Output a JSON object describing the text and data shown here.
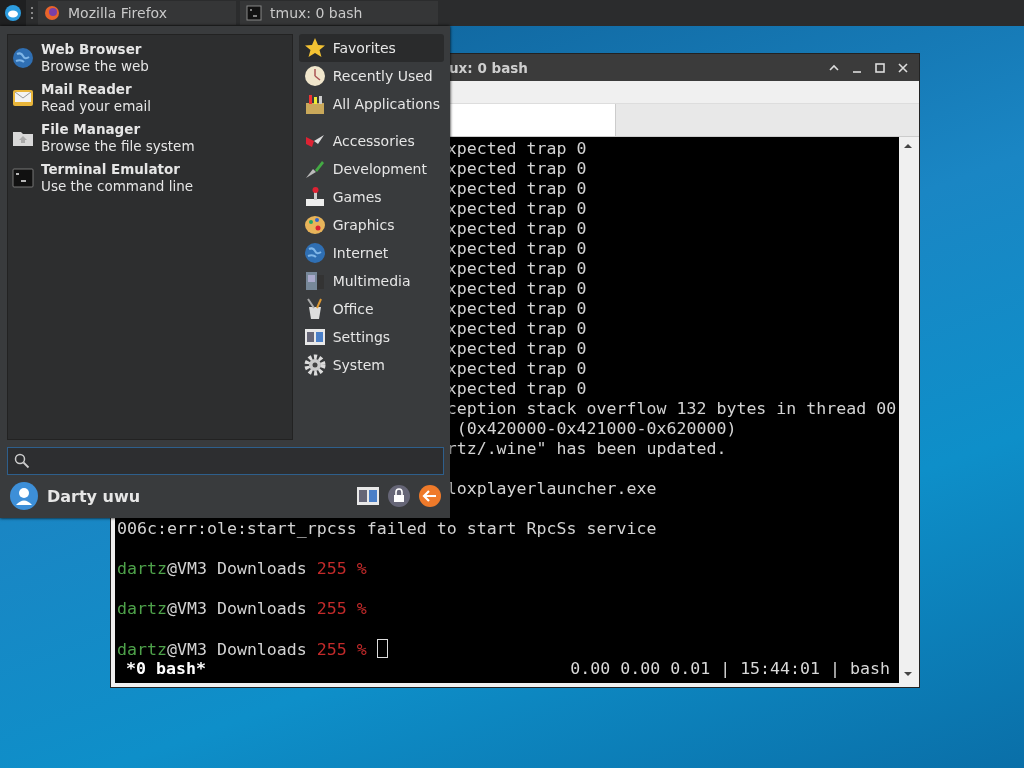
{
  "panel": {
    "tasks": [
      {
        "label": "Mozilla Firefox",
        "kind": "browser"
      },
      {
        "label": "tmux: 0 bash",
        "kind": "terminal"
      }
    ]
  },
  "terminal": {
    "title": "ux: 0 bash",
    "lines": [
      {
        "kind": "clipped",
        "text": "xpected trap 0"
      },
      {
        "kind": "clipped",
        "text": "xpected trap 0"
      },
      {
        "kind": "clipped",
        "text": "xpected trap 0"
      },
      {
        "kind": "clipped",
        "text": "xpected trap 0"
      },
      {
        "kind": "clipped",
        "text": "xpected trap 0"
      },
      {
        "kind": "clipped",
        "text": "xpected trap 0"
      },
      {
        "kind": "clipped",
        "text": "xpected trap 0"
      },
      {
        "kind": "clipped",
        "text": "xpected trap 0"
      },
      {
        "kind": "clipped",
        "text": "xpected trap 0"
      },
      {
        "kind": "clipped",
        "text": "xpected trap 0"
      },
      {
        "kind": "clipped",
        "text": "xpected trap 0"
      },
      {
        "kind": "clipped",
        "text": "xpected trap 0"
      },
      {
        "kind": "clipped",
        "text": "xpected trap 0"
      },
      {
        "kind": "clipped",
        "text": "ception stack overflow 132 bytes in thread 00"
      },
      {
        "kind": "clipped",
        "text": " (0x420000-0x421000-0x620000)"
      },
      {
        "kind": "clipped",
        "text": "rtz/.wine\" has been updated."
      },
      {
        "kind": "blank"
      },
      {
        "kind": "clipped",
        "text": "loxplayerlauncher.exe"
      },
      {
        "kind": "blank"
      },
      {
        "kind": "full",
        "text": "006c:err:ole:start_rpcss failed to start RpcSs service"
      },
      {
        "kind": "blank"
      },
      {
        "kind": "prompt",
        "user": "dartz",
        "path": "@VM3 Downloads",
        "code": "255 %",
        "cursor": false
      },
      {
        "kind": "blank"
      },
      {
        "kind": "prompt",
        "user": "dartz",
        "path": "@VM3 Downloads",
        "code": "255 %",
        "cursor": false
      },
      {
        "kind": "blank"
      },
      {
        "kind": "prompt",
        "user": "dartz",
        "path": "@VM3 Downloads",
        "code": "255 %",
        "cursor": true
      }
    ],
    "status_left": "*0 bash*",
    "status_right": "0.00 0.00 0.01 | 15:44:01 | bash"
  },
  "menu": {
    "apps": [
      {
        "title": "Web Browser",
        "subtitle": "Browse the web"
      },
      {
        "title": "Mail Reader",
        "subtitle": "Read your email"
      },
      {
        "title": "File Manager",
        "subtitle": "Browse the file system"
      },
      {
        "title": "Terminal Emulator",
        "subtitle": "Use the command line"
      }
    ],
    "views": [
      {
        "label": "Favorites",
        "selected": true
      },
      {
        "label": "Recently Used",
        "selected": false
      },
      {
        "label": "All Applications",
        "selected": false
      }
    ],
    "categories": [
      {
        "label": "Accessories",
        "selected": false
      },
      {
        "label": "Development",
        "selected": false
      },
      {
        "label": "Games",
        "selected": false
      },
      {
        "label": "Graphics",
        "selected": false
      },
      {
        "label": "Internet",
        "selected": false
      },
      {
        "label": "Multimedia",
        "selected": false
      },
      {
        "label": "Office",
        "selected": false
      },
      {
        "label": "Settings",
        "selected": false
      },
      {
        "label": "System",
        "selected": false
      }
    ],
    "user": "Darty uwu"
  }
}
